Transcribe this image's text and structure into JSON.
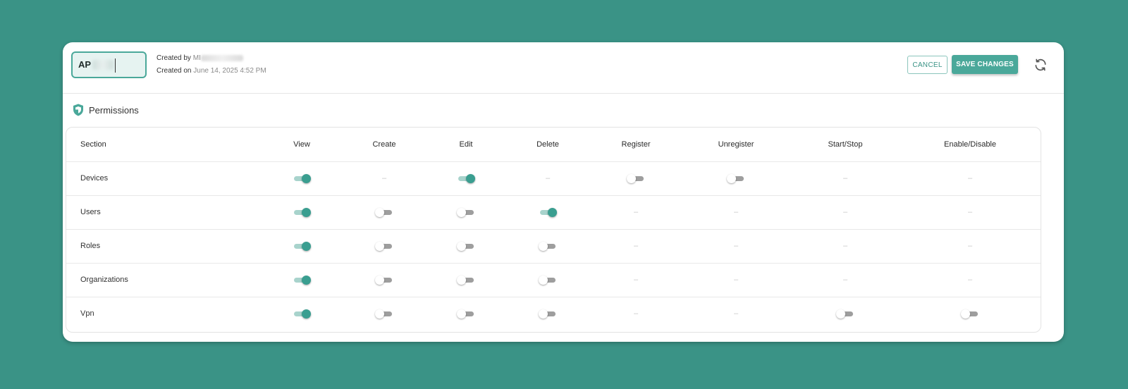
{
  "header": {
    "name_value": "AP",
    "created_by_label": "Created by",
    "created_by_value": "MI",
    "created_on_label": "Created on",
    "created_on_value": "June 14, 2025 4:52 PM",
    "cancel_label": "CANCEL",
    "save_label": "SAVE CHANGES"
  },
  "permissions": {
    "title": "Permissions",
    "columns": [
      "Section",
      "View",
      "Create",
      "Edit",
      "Delete",
      "Register",
      "Unregister",
      "Start/Stop",
      "Enable/Disable"
    ],
    "dash": "–",
    "rows": [
      {
        "label": "Devices",
        "cells": [
          "on",
          "none",
          "on",
          "none",
          "off",
          "off",
          "none",
          "none"
        ]
      },
      {
        "label": "Users",
        "cells": [
          "on",
          "off",
          "off",
          "on",
          "none",
          "none",
          "none",
          "none"
        ]
      },
      {
        "label": "Roles",
        "cells": [
          "on",
          "off",
          "off",
          "off",
          "none",
          "none",
          "none",
          "none"
        ]
      },
      {
        "label": "Organizations",
        "cells": [
          "on",
          "off",
          "off",
          "off",
          "none",
          "none",
          "none",
          "none"
        ]
      },
      {
        "label": "Vpn",
        "cells": [
          "on",
          "off",
          "off",
          "off",
          "none",
          "none",
          "off",
          "off"
        ]
      }
    ]
  },
  "icons": {
    "refresh": "refresh-icon",
    "shield": "shield-icon"
  },
  "colors": {
    "background": "#3a9386",
    "accent": "#4aa89a",
    "toggle_on": "#3a9e90",
    "toggle_off": "#9e9e9e"
  }
}
